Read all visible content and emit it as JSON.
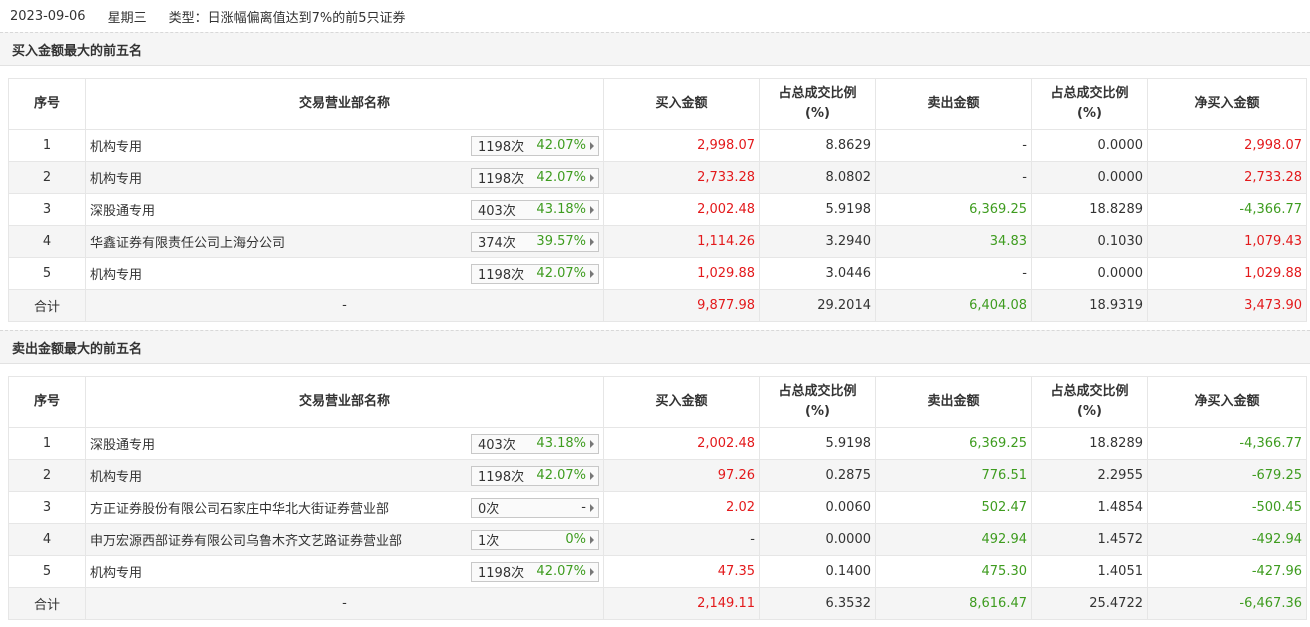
{
  "header": {
    "date": "2023-09-06",
    "weekday": "星期三",
    "type_text": "类型：日涨幅偏离值达到7%的前5只证券"
  },
  "columns": [
    "序号",
    "交易营业部名称",
    "买入金额",
    "占总成交比例(%)",
    "卖出金额",
    "占总成交比例(%)",
    "净买入金额"
  ],
  "col_pct_line1": "占总成交比例",
  "col_pct_line2": "(%)",
  "colors": {
    "up": "#e3191b",
    "down": "#3e9c1f"
  },
  "buy_section": {
    "title": "买入金额最大的前五名",
    "rows": [
      {
        "no": "1",
        "name": "机构专用",
        "times": "1198次",
        "rate": "42.07%",
        "buy": "2,998.07",
        "buy_pct": "8.8629",
        "sell": "-",
        "sell_pct": "0.0000",
        "net": "2,998.07"
      },
      {
        "no": "2",
        "name": "机构专用",
        "times": "1198次",
        "rate": "42.07%",
        "buy": "2,733.28",
        "buy_pct": "8.0802",
        "sell": "-",
        "sell_pct": "0.0000",
        "net": "2,733.28"
      },
      {
        "no": "3",
        "name": "深股通专用",
        "times": "403次",
        "rate": "43.18%",
        "buy": "2,002.48",
        "buy_pct": "5.9198",
        "sell": "6,369.25",
        "sell_pct": "18.8289",
        "net": "-4,366.77"
      },
      {
        "no": "4",
        "name": "华鑫证券有限责任公司上海分公司",
        "times": "374次",
        "rate": "39.57%",
        "buy": "1,114.26",
        "buy_pct": "3.2940",
        "sell": "34.83",
        "sell_pct": "0.1030",
        "net": "1,079.43"
      },
      {
        "no": "5",
        "name": "机构专用",
        "times": "1198次",
        "rate": "42.07%",
        "buy": "1,029.88",
        "buy_pct": "3.0446",
        "sell": "-",
        "sell_pct": "0.0000",
        "net": "1,029.88"
      }
    ],
    "total": {
      "label": "合计",
      "name": "-",
      "buy": "9,877.98",
      "buy_pct": "29.2014",
      "sell": "6,404.08",
      "sell_pct": "18.9319",
      "net": "3,473.90"
    }
  },
  "sell_section": {
    "title": "卖出金额最大的前五名",
    "rows": [
      {
        "no": "1",
        "name": "深股通专用",
        "times": "403次",
        "rate": "43.18%",
        "buy": "2,002.48",
        "buy_pct": "5.9198",
        "sell": "6,369.25",
        "sell_pct": "18.8289",
        "net": "-4,366.77"
      },
      {
        "no": "2",
        "name": "机构专用",
        "times": "1198次",
        "rate": "42.07%",
        "buy": "97.26",
        "buy_pct": "0.2875",
        "sell": "776.51",
        "sell_pct": "2.2955",
        "net": "-679.25"
      },
      {
        "no": "3",
        "name": "方正证券股份有限公司石家庄中华北大街证券营业部",
        "times": "0次",
        "rate": "-",
        "buy": "2.02",
        "buy_pct": "0.0060",
        "sell": "502.47",
        "sell_pct": "1.4854",
        "net": "-500.45"
      },
      {
        "no": "4",
        "name": "申万宏源西部证券有限公司乌鲁木齐文艺路证券营业部",
        "times": "1次",
        "rate": "0%",
        "buy": "-",
        "buy_pct": "0.0000",
        "sell": "492.94",
        "sell_pct": "1.4572",
        "net": "-492.94"
      },
      {
        "no": "5",
        "name": "机构专用",
        "times": "1198次",
        "rate": "42.07%",
        "buy": "47.35",
        "buy_pct": "0.1400",
        "sell": "475.30",
        "sell_pct": "1.4051",
        "net": "-427.96"
      }
    ],
    "total": {
      "label": "合计",
      "name": "-",
      "buy": "2,149.11",
      "buy_pct": "6.3532",
      "sell": "8,616.47",
      "sell_pct": "25.4722",
      "net": "-6,467.36"
    }
  }
}
